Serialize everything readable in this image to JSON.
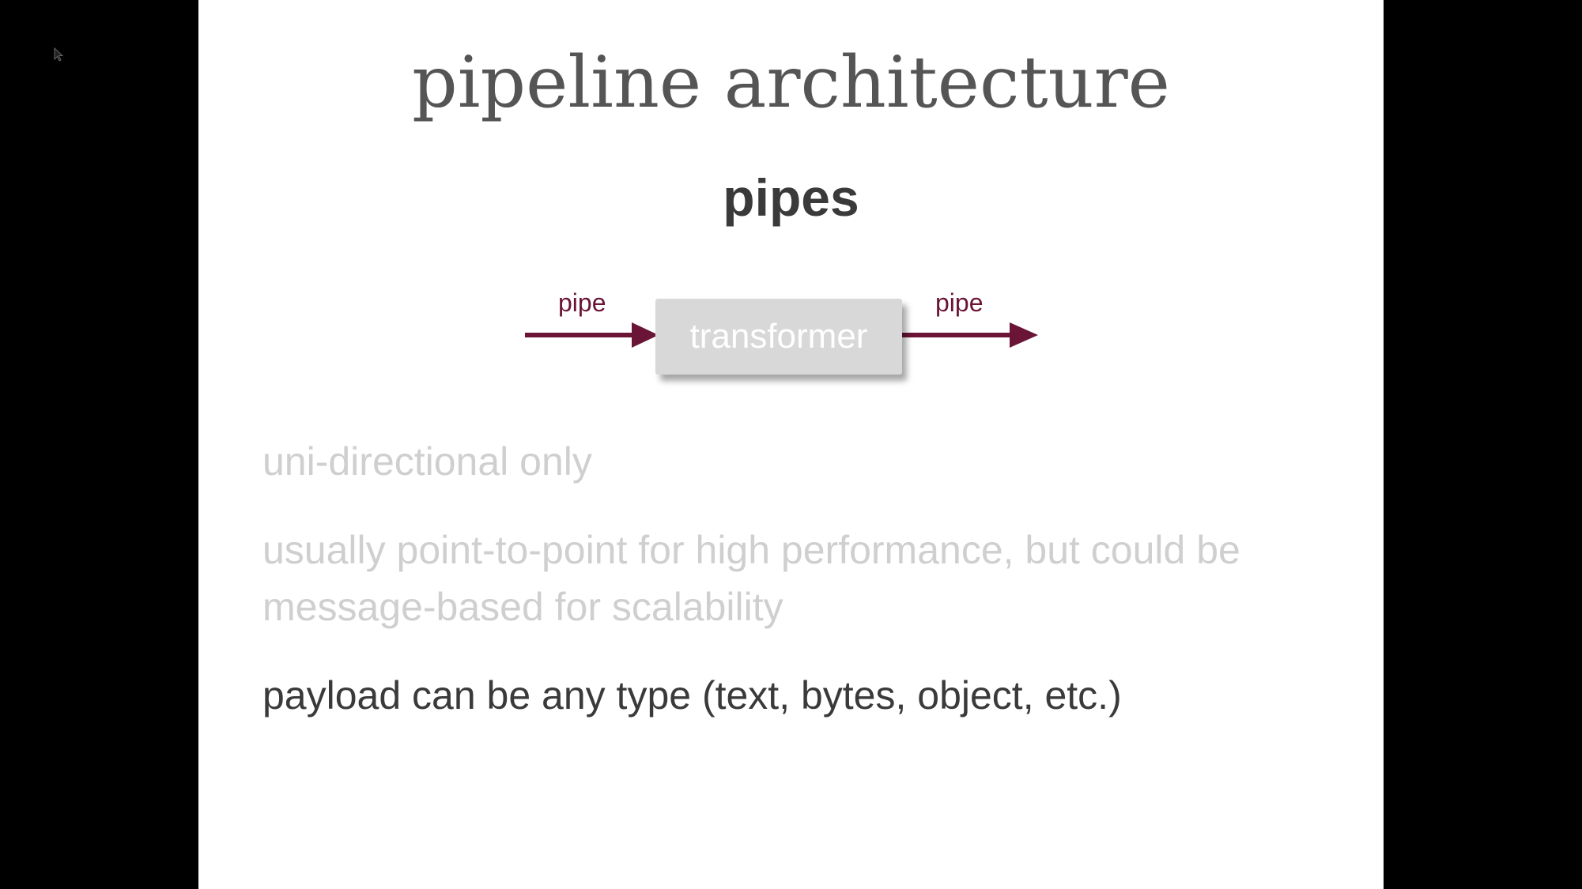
{
  "slide": {
    "title": "pipeline architecture",
    "subtitle": "pipes",
    "diagram": {
      "left_pipe_label": "pipe",
      "box_label": "transformer",
      "right_pipe_label": "pipe",
      "arrow_color": "#6a1436",
      "box_color": "#d8d8d8"
    },
    "bullets": [
      {
        "text": "uni-directional only",
        "state": "dim"
      },
      {
        "text": "usually point-to-point for high performance, but could be message-based for scalability",
        "state": "dim"
      },
      {
        "text": "payload can be any type (text, bytes, object, etc.)",
        "state": "active"
      }
    ]
  },
  "colors": {
    "background": "#000000",
    "slide": "#ffffff",
    "title": "#555555",
    "dim_text": "#cfcfcf",
    "active_text": "#3a3a3a"
  },
  "icons": {
    "cursor": "mouse-pointer-icon"
  }
}
